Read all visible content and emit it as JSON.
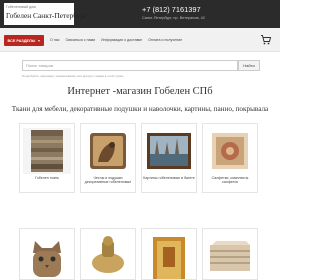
{
  "header": {
    "subtitle": "Гобеленовый дом",
    "store_name": "Гобелен Санкт-Петербург",
    "phone": "+7 (812) 7161397",
    "address": "Санкт-Петербург, пр. Ветеранов, 42"
  },
  "nav": {
    "sections_label": "ВСЕ РАЗДЕЛЫ",
    "links": [
      "О нас",
      "Связаться с нами",
      "Информация о доставке",
      "Оплата и получение"
    ]
  },
  "search": {
    "placeholder": "Поиск товаров",
    "button_label": "Найти",
    "hint": "Попробуйте, например: наименование или артикул товара в этой строке"
  },
  "main": {
    "title": "Интернет -магазин Гобелен СПб",
    "subtitle": "Ткани для мебели, декоративные подушки и наволочки, картины, панно, покрывала"
  },
  "categories": [
    {
      "label": "Гобелен ткань"
    },
    {
      "label": "Чехлы и подушки декоративные гобеленовые"
    },
    {
      "label": "Картины гобеленовые в багете"
    },
    {
      "label": "Салфетки, комплекты салфеток"
    }
  ]
}
